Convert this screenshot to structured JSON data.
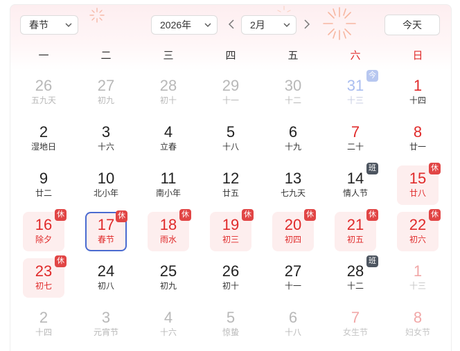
{
  "toolbar": {
    "holiday_select": "春节",
    "year_select": "2026年",
    "month_select": "2月",
    "today_button": "今天"
  },
  "weekdays": [
    {
      "label": "一",
      "weekend": false
    },
    {
      "label": "二",
      "weekend": false
    },
    {
      "label": "三",
      "weekend": false
    },
    {
      "label": "四",
      "weekend": false
    },
    {
      "label": "五",
      "weekend": false
    },
    {
      "label": "六",
      "weekend": true
    },
    {
      "label": "日",
      "weekend": true
    }
  ],
  "weeks": [
    [
      {
        "day": "26",
        "sub": "五九天",
        "type": "other"
      },
      {
        "day": "27",
        "sub": "初九",
        "type": "other"
      },
      {
        "day": "28",
        "sub": "初十",
        "type": "other"
      },
      {
        "day": "29",
        "sub": "十一",
        "type": "other"
      },
      {
        "day": "30",
        "sub": "十二",
        "type": "other"
      },
      {
        "day": "31",
        "sub": "十三",
        "type": "today",
        "badge": "今"
      },
      {
        "day": "1",
        "sub": "十四",
        "type": "red"
      }
    ],
    [
      {
        "day": "2",
        "sub": "湿地日",
        "type": "normal"
      },
      {
        "day": "3",
        "sub": "十六",
        "type": "normal"
      },
      {
        "day": "4",
        "sub": "立春",
        "type": "normal"
      },
      {
        "day": "5",
        "sub": "十八",
        "type": "normal"
      },
      {
        "day": "6",
        "sub": "十九",
        "type": "normal"
      },
      {
        "day": "7",
        "sub": "二十",
        "type": "red"
      },
      {
        "day": "8",
        "sub": "廿一",
        "type": "red"
      }
    ],
    [
      {
        "day": "9",
        "sub": "廿二",
        "type": "normal"
      },
      {
        "day": "10",
        "sub": "北小年",
        "type": "normal"
      },
      {
        "day": "11",
        "sub": "南小年",
        "type": "normal"
      },
      {
        "day": "12",
        "sub": "廿五",
        "type": "normal"
      },
      {
        "day": "13",
        "sub": "七九天",
        "type": "normal"
      },
      {
        "day": "14",
        "sub": "情人节",
        "type": "normal",
        "badge": "班"
      },
      {
        "day": "15",
        "sub": "廿八",
        "type": "holiday",
        "badge": "休"
      }
    ],
    [
      {
        "day": "16",
        "sub": "除夕",
        "type": "holiday",
        "badge": "休"
      },
      {
        "day": "17",
        "sub": "春节",
        "type": "selected",
        "badge": "休"
      },
      {
        "day": "18",
        "sub": "雨水",
        "type": "holiday",
        "badge": "休"
      },
      {
        "day": "19",
        "sub": "初三",
        "type": "holiday",
        "badge": "休"
      },
      {
        "day": "20",
        "sub": "初四",
        "type": "holiday",
        "badge": "休"
      },
      {
        "day": "21",
        "sub": "初五",
        "type": "holiday",
        "badge": "休"
      },
      {
        "day": "22",
        "sub": "初六",
        "type": "holiday",
        "badge": "休"
      }
    ],
    [
      {
        "day": "23",
        "sub": "初七",
        "type": "holiday",
        "badge": "休"
      },
      {
        "day": "24",
        "sub": "初八",
        "type": "normal"
      },
      {
        "day": "25",
        "sub": "初九",
        "type": "normal"
      },
      {
        "day": "26",
        "sub": "初十",
        "type": "normal"
      },
      {
        "day": "27",
        "sub": "十一",
        "type": "normal"
      },
      {
        "day": "28",
        "sub": "十二",
        "type": "normal",
        "badge": "班"
      },
      {
        "day": "1",
        "sub": "十三",
        "type": "pale"
      }
    ],
    [
      {
        "day": "2",
        "sub": "十四",
        "type": "other"
      },
      {
        "day": "3",
        "sub": "元宵节",
        "type": "other"
      },
      {
        "day": "4",
        "sub": "十六",
        "type": "other"
      },
      {
        "day": "5",
        "sub": "惊蛰",
        "type": "other"
      },
      {
        "day": "6",
        "sub": "十八",
        "type": "other"
      },
      {
        "day": "7",
        "sub": "女生节",
        "type": "pale"
      },
      {
        "day": "8",
        "sub": "妇女节",
        "type": "pale"
      }
    ]
  ]
}
